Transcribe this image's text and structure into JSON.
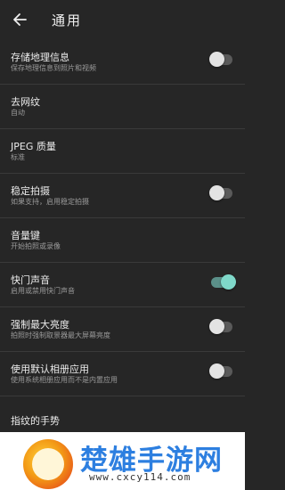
{
  "header": {
    "title": "通用",
    "back_icon": "arrow-left-icon"
  },
  "settings": [
    {
      "label": "存储地理信息",
      "sub": "保存地理信息到照片和视频",
      "toggle": false
    },
    {
      "label": "去网纹",
      "sub": "自动"
    },
    {
      "label": "JPEG 质量",
      "sub": "标准"
    },
    {
      "label": "稳定拍摄",
      "sub": "如果支持，启用稳定拍摄",
      "toggle": false
    },
    {
      "label": "音量键",
      "sub": "开始拍照或录像"
    },
    {
      "label": "快门声音",
      "sub": "启用或禁用快门声音",
      "toggle": true
    },
    {
      "label": "强制最大亮度",
      "sub": "拍照时强制取景器最大屏幕亮度",
      "toggle": false
    },
    {
      "label": "使用默认相册应用",
      "sub": "使用系统相册应用而不是内置应用",
      "toggle": false
    },
    {
      "label": "指纹的手势"
    }
  ],
  "watermark": {
    "title": "楚雄手游网",
    "url": "www.cxcy114.com"
  },
  "colors": {
    "background": "#262626",
    "toggle_on_track": "#5b9089",
    "toggle_on_knob": "#7fd8c9",
    "toggle_off_knob": "#e3e3e3",
    "watermark_text": "#2d7fe0"
  }
}
